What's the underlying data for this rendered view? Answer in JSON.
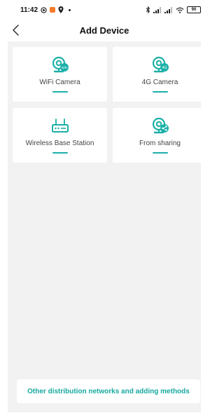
{
  "status_bar": {
    "time": "11:42",
    "battery": "90"
  },
  "header": {
    "title": "Add Device"
  },
  "devices": [
    {
      "label": "WiFi Camera",
      "icon": "wifi-camera-icon",
      "badge": "WiFi"
    },
    {
      "label": "4G Camera",
      "icon": "4g-camera-icon",
      "badge": "4G"
    },
    {
      "label": "Wireless Base Station",
      "icon": "base-station-icon"
    },
    {
      "label": "From sharing",
      "icon": "share-camera-icon"
    }
  ],
  "footer": {
    "other_methods_label": "Other distribution networks and adding methods"
  },
  "colors": {
    "accent": "#1ab0a8",
    "background": "#f2f2f2",
    "card": "#ffffff"
  }
}
